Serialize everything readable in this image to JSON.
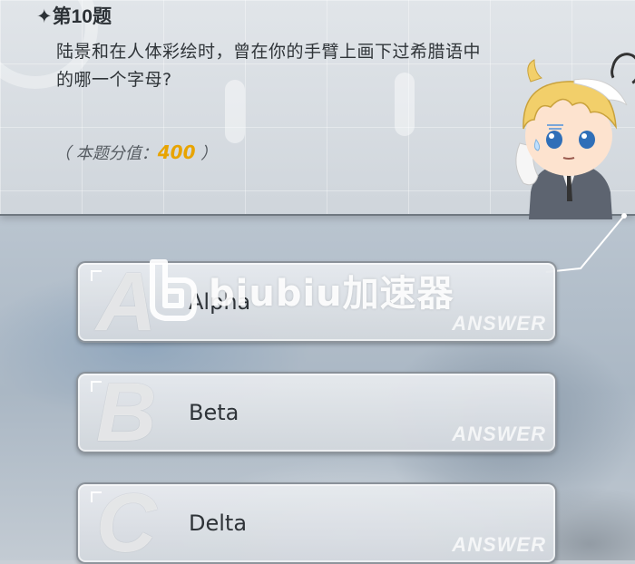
{
  "question": {
    "number": "✦第10题",
    "text": "陆景和在人体彩绘时，曾在你的手臂上画下过希腊语中的哪一个字母?",
    "score_label": "（ 本题分值：",
    "score_value": "400",
    "score_close": " ）"
  },
  "answers": [
    {
      "letter": "A",
      "label": "Alpha",
      "watermark": "ANSWER"
    },
    {
      "letter": "B",
      "label": "Beta",
      "watermark": "ANSWER"
    },
    {
      "letter": "C",
      "label": "Delta",
      "watermark": "ANSWER"
    }
  ],
  "overlay": {
    "text": "biubiu加速器"
  },
  "colors": {
    "score": "#e8a400",
    "text": "#2e3338"
  }
}
